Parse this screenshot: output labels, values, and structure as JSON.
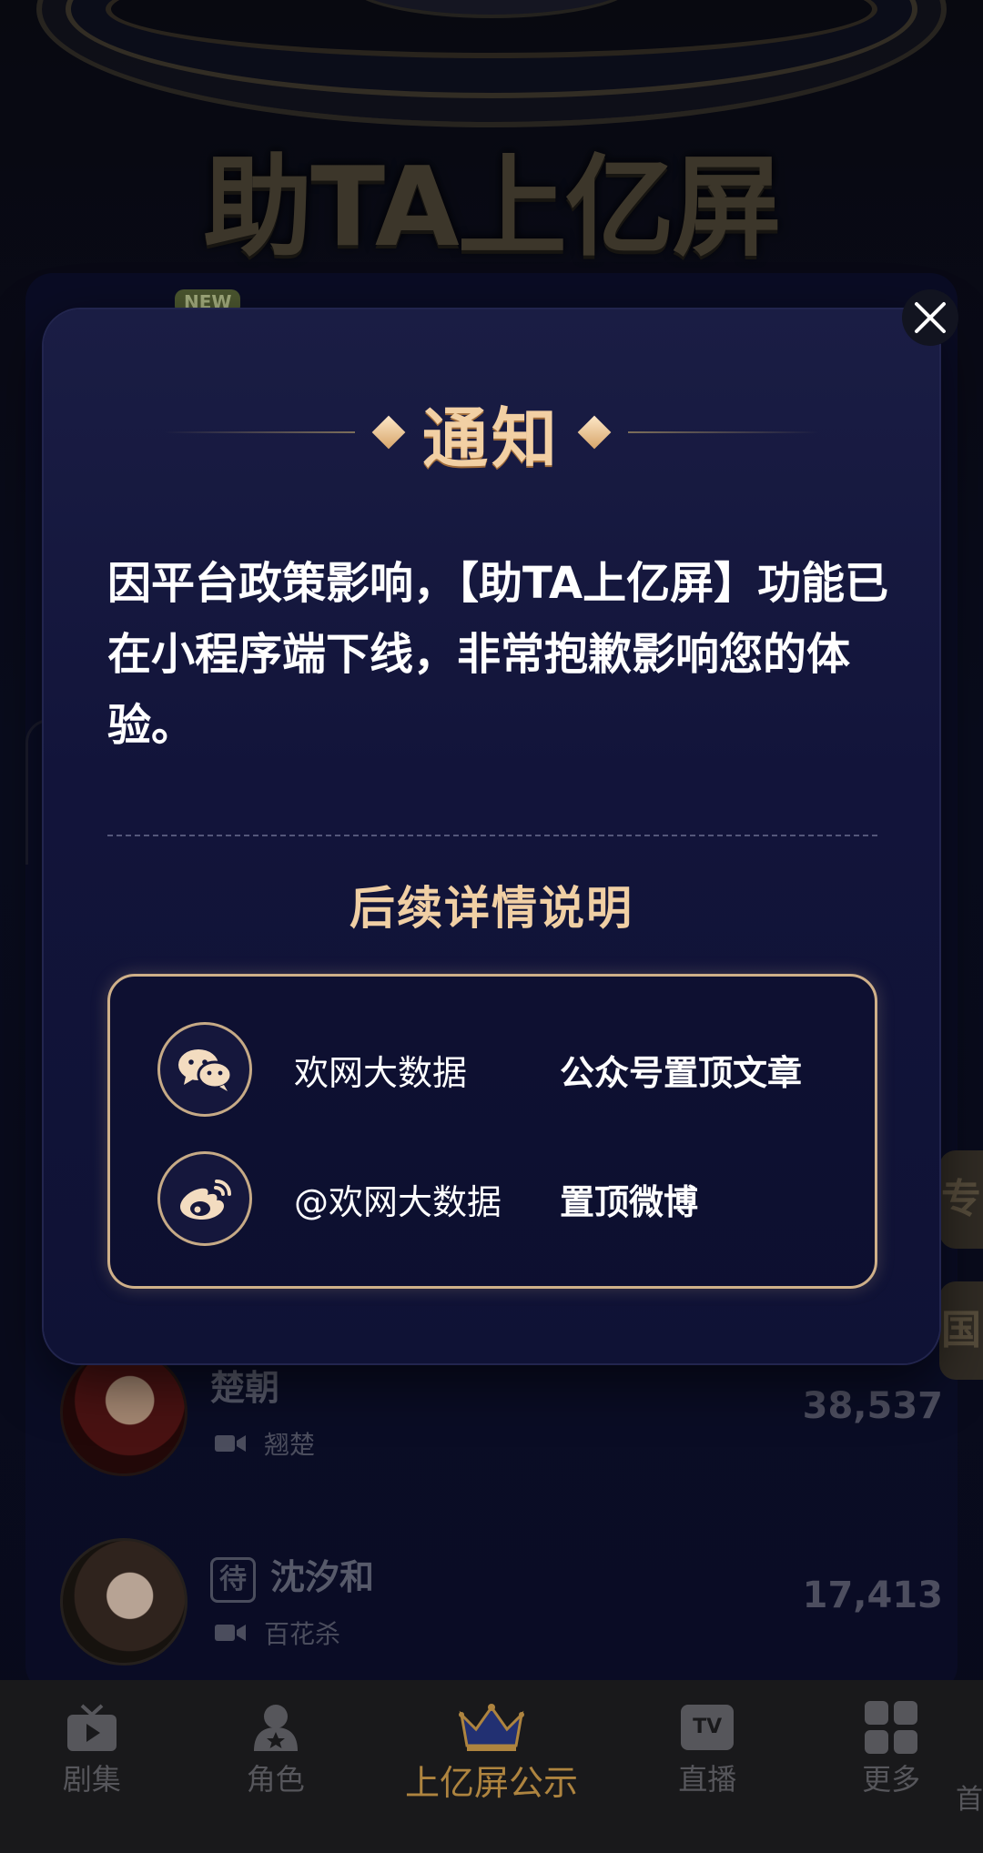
{
  "background": {
    "banner_title": "助TA上亿屏",
    "new_badge": "NEW",
    "side_tab_1": "专",
    "side_tab_2": "国",
    "list": [
      {
        "name": "楚朝",
        "badge": "",
        "drama": "翘楚",
        "count": "38,537"
      },
      {
        "name": "沈汐和",
        "badge": "待",
        "drama": "百花杀",
        "count": "17,413"
      }
    ]
  },
  "modal": {
    "title": "通知",
    "message": "因平台政策影响，【助TA上亿屏】功能已在小程序端下线，非常抱歉影响您的体验。",
    "subtitle": "后续详情说明",
    "rows": [
      {
        "icon": "wechat-icon",
        "account": "欢网大数据",
        "location": "公众号置顶文章"
      },
      {
        "icon": "weibo-icon",
        "account": "@欢网大数据",
        "location": "置顶微博"
      }
    ]
  },
  "tabbar": {
    "tabs": [
      {
        "label": "剧集",
        "icon": "tv-play-icon"
      },
      {
        "label": "角色",
        "icon": "role-icon"
      },
      {
        "label": "上亿屏公示",
        "icon": "crown-icon"
      },
      {
        "label": "直播",
        "icon": "tv-live-icon",
        "icon_text": "TV"
      },
      {
        "label": "更多",
        "icon": "grid-more-icon"
      }
    ],
    "active_index": 2,
    "corner_glyph": "首"
  },
  "colors": {
    "accent_gold": "#d5a24e",
    "title_gold": "#f2d0a4",
    "modal_bg": "#14173c"
  }
}
